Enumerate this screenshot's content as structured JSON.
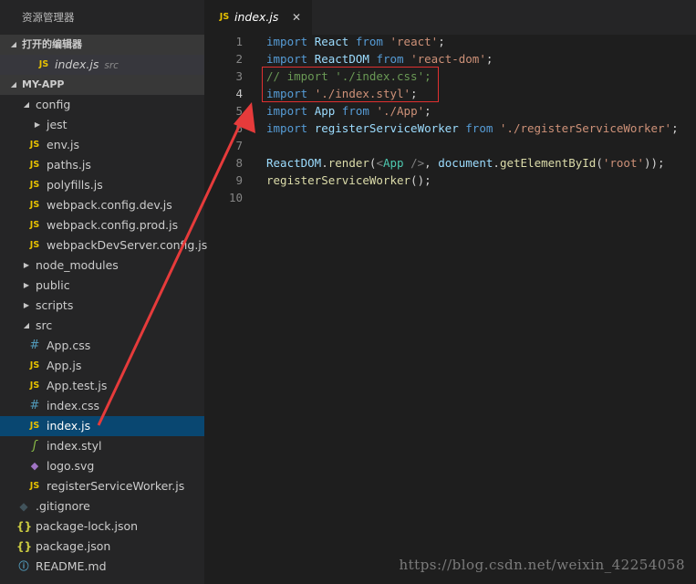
{
  "explorer": {
    "title": "资源管理器",
    "open_editors": {
      "header": "打开的编辑器",
      "items": [
        {
          "icon": "js-file-icon",
          "name": "index.js",
          "path": "src"
        }
      ]
    },
    "project": {
      "header": "MY-APP",
      "tree": [
        {
          "label": "config",
          "type": "folder",
          "expanded": true,
          "depth": 1
        },
        {
          "label": "jest",
          "type": "folder",
          "expanded": false,
          "depth": 2
        },
        {
          "label": "env.js",
          "type": "js",
          "depth": 2
        },
        {
          "label": "paths.js",
          "type": "js",
          "depth": 2
        },
        {
          "label": "polyfills.js",
          "type": "js",
          "depth": 2
        },
        {
          "label": "webpack.config.dev.js",
          "type": "js",
          "depth": 2
        },
        {
          "label": "webpack.config.prod.js",
          "type": "js",
          "depth": 2
        },
        {
          "label": "webpackDevServer.config.js",
          "type": "js",
          "depth": 2
        },
        {
          "label": "node_modules",
          "type": "folder",
          "expanded": false,
          "depth": 1
        },
        {
          "label": "public",
          "type": "folder",
          "expanded": false,
          "depth": 1
        },
        {
          "label": "scripts",
          "type": "folder",
          "expanded": false,
          "depth": 1
        },
        {
          "label": "src",
          "type": "folder",
          "expanded": true,
          "depth": 1
        },
        {
          "label": "App.css",
          "type": "css",
          "depth": 2
        },
        {
          "label": "App.js",
          "type": "js",
          "depth": 2
        },
        {
          "label": "App.test.js",
          "type": "js",
          "depth": 2
        },
        {
          "label": "index.css",
          "type": "css",
          "depth": 2
        },
        {
          "label": "index.js",
          "type": "js",
          "depth": 2,
          "selected": true
        },
        {
          "label": "index.styl",
          "type": "styl",
          "depth": 2
        },
        {
          "label": "logo.svg",
          "type": "svg",
          "depth": 2
        },
        {
          "label": "registerServiceWorker.js",
          "type": "js",
          "depth": 2
        },
        {
          "label": ".gitignore",
          "type": "git",
          "depth": 1
        },
        {
          "label": "package-lock.json",
          "type": "json",
          "depth": 1
        },
        {
          "label": "package.json",
          "type": "json",
          "depth": 1
        },
        {
          "label": "README.md",
          "type": "md",
          "depth": 1
        }
      ]
    }
  },
  "icons": {
    "js": "JS",
    "css": "#",
    "json": "{}",
    "styl": "ʃ",
    "svg": "◆",
    "git": "◆",
    "md": "ⓘ",
    "twisty_open": "◢",
    "twisty_closed": "▶",
    "close": "✕"
  },
  "tab": {
    "label": "index.js",
    "icon": "JS",
    "close": "✕"
  },
  "editor": {
    "active_line": 4,
    "lines": [
      [
        [
          "kw",
          "import"
        ],
        [
          "plain",
          " "
        ],
        [
          "id",
          "React"
        ],
        [
          "plain",
          " "
        ],
        [
          "kw",
          "from"
        ],
        [
          "plain",
          " "
        ],
        [
          "str",
          "'react'"
        ],
        [
          "plain",
          ";"
        ]
      ],
      [
        [
          "kw",
          "import"
        ],
        [
          "plain",
          " "
        ],
        [
          "id",
          "ReactDOM"
        ],
        [
          "plain",
          " "
        ],
        [
          "kw",
          "from"
        ],
        [
          "plain",
          " "
        ],
        [
          "str",
          "'react-dom'"
        ],
        [
          "plain",
          ";"
        ]
      ],
      [
        [
          "cm",
          "// import './index.css';"
        ]
      ],
      [
        [
          "kw",
          "import"
        ],
        [
          "plain",
          " "
        ],
        [
          "str",
          "'./index.styl'"
        ],
        [
          "plain",
          ";"
        ]
      ],
      [
        [
          "kw",
          "import"
        ],
        [
          "plain",
          " "
        ],
        [
          "id",
          "App"
        ],
        [
          "plain",
          " "
        ],
        [
          "kw",
          "from"
        ],
        [
          "plain",
          " "
        ],
        [
          "str",
          "'./App'"
        ],
        [
          "plain",
          ";"
        ]
      ],
      [
        [
          "kw",
          "import"
        ],
        [
          "plain",
          " "
        ],
        [
          "id",
          "registerServiceWorker"
        ],
        [
          "plain",
          " "
        ],
        [
          "kw",
          "from"
        ],
        [
          "plain",
          " "
        ],
        [
          "str",
          "'./registerServiceWorker'"
        ],
        [
          "plain",
          ";"
        ]
      ],
      [],
      [
        [
          "id",
          "ReactDOM"
        ],
        [
          "plain",
          "."
        ],
        [
          "fn",
          "render"
        ],
        [
          "plain",
          "("
        ],
        [
          "punc",
          "<"
        ],
        [
          "tag",
          "App"
        ],
        [
          "plain",
          " "
        ],
        [
          "punc",
          "/>"
        ],
        [
          "plain",
          ", "
        ],
        [
          "id",
          "document"
        ],
        [
          "plain",
          "."
        ],
        [
          "fn",
          "getElementById"
        ],
        [
          "plain",
          "("
        ],
        [
          "str",
          "'root'"
        ],
        [
          "plain",
          "));"
        ]
      ],
      [
        [
          "fn",
          "registerServiceWorker"
        ],
        [
          "plain",
          "();"
        ]
      ],
      []
    ]
  },
  "watermark": "https://blog.csdn.net/weixin_42254058"
}
